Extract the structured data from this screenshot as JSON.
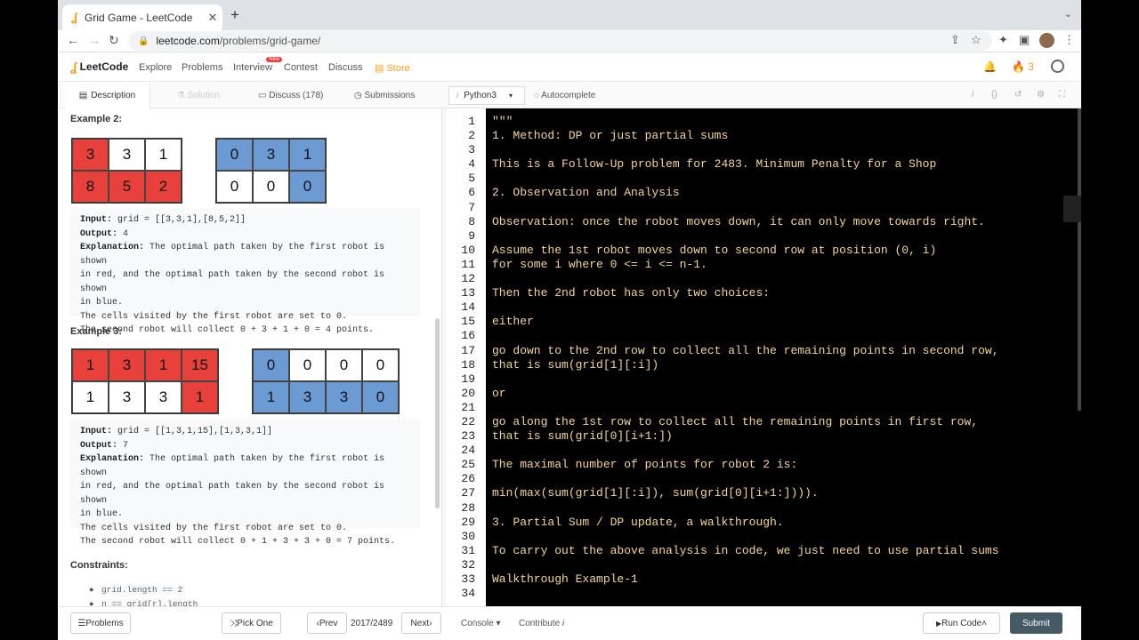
{
  "browser": {
    "tab_title": "Grid Game - LeetCode",
    "url_host": "leetcode.com",
    "url_path": "/problems/grid-game/"
  },
  "header": {
    "logo": "LeetCode",
    "nav": [
      "Explore",
      "Problems",
      "Interview",
      "Contest",
      "Discuss",
      "Store"
    ],
    "new_badge": "New",
    "streak": "3"
  },
  "subtabs": {
    "description": "Description",
    "solution": "Solution",
    "discuss": "Discuss (178)",
    "submissions": "Submissions",
    "language": "Python3",
    "autocomplete": "Autocomplete"
  },
  "example2": {
    "title": "Example 2:",
    "grid_a": [
      [
        "3",
        "3",
        "1"
      ],
      [
        "8",
        "5",
        "2"
      ]
    ],
    "grid_b": [
      [
        "0",
        "3",
        "1"
      ],
      [
        "0",
        "0",
        "0"
      ]
    ],
    "input_label": "Input:",
    "input": "grid = [[3,3,1],[8,5,2]]",
    "output_label": "Output:",
    "output": "4",
    "expl_label": "Explanation:",
    "expl1": "The optimal path taken by the first robot is shown",
    "expl2": "in red, and the optimal path taken by the second robot is shown",
    "expl3": "in blue.",
    "expl4": "The cells visited by the first robot are set to 0.",
    "expl5": "The second robot will collect 0 + 3 + 1 + 0 = 4 points."
  },
  "example3": {
    "title": "Example 3:",
    "grid_a": [
      [
        "1",
        "3",
        "1",
        "15"
      ],
      [
        "1",
        "3",
        "3",
        "1"
      ]
    ],
    "grid_b": [
      [
        "0",
        "0",
        "0",
        "0"
      ],
      [
        "1",
        "3",
        "3",
        "0"
      ]
    ],
    "input_label": "Input:",
    "input": "grid = [[1,3,1,15],[1,3,3,1]]",
    "output_label": "Output:",
    "output": "7",
    "expl_label": "Explanation:",
    "expl1": "The optimal path taken by the first robot is shown",
    "expl2": "in red, and the optimal path taken by the second robot is shown",
    "expl3": "in blue.",
    "expl4": "The cells visited by the first robot are set to 0.",
    "expl5": "The second robot will collect 0 + 1 + 3 + 3 + 0 = 7 points."
  },
  "constraints": {
    "title": "Constraints:",
    "c1": "grid.length == 2",
    "c2": "n == grid[r].length"
  },
  "code_lines": [
    "\"\"\"",
    "1. Method: DP or just partial sums",
    "",
    "This is a Follow-Up problem for 2483. Minimum Penalty for a Shop",
    "",
    "2. Observation and Analysis",
    "",
    "Observation: once the robot moves down, it can only move towards right.",
    "",
    "Assume the 1st robot moves down to second row at position (0, i)",
    "for some i where 0 <= i <= n-1.",
    "",
    "Then the 2nd robot has only two choices:",
    "",
    "either",
    "",
    "go down to the 2nd row to collect all the remaining points in second row,",
    "that is sum(grid[1][:i])",
    "",
    "or",
    "",
    "go along the 1st row to collect all the remaining points in first row,",
    "that is sum(grid[0][i+1:])",
    "",
    "The maximal number of points for robot 2 is:",
    "",
    "min(max(sum(grid[1][:i]), sum(grid[0][i+1:]))).",
    "",
    "3. Partial Sum / DP update, a walkthrough.",
    "",
    "To carry out the above analysis in code, we just need to use partial sums",
    "",
    "Walkthrough Example-1",
    ""
  ],
  "bottom": {
    "problems": "Problems",
    "pick_one": "Pick One",
    "prev": "Prev",
    "counter": "2017/2489",
    "next": "Next",
    "console": "Console",
    "contribute": "Contribute",
    "run_code": "Run Code",
    "submit": "Submit"
  },
  "colors": {
    "red_cell": "#e8413b",
    "blue_cell": "#6c9ad2",
    "code_text": "#f7d594",
    "accent": "#f89f1b"
  }
}
